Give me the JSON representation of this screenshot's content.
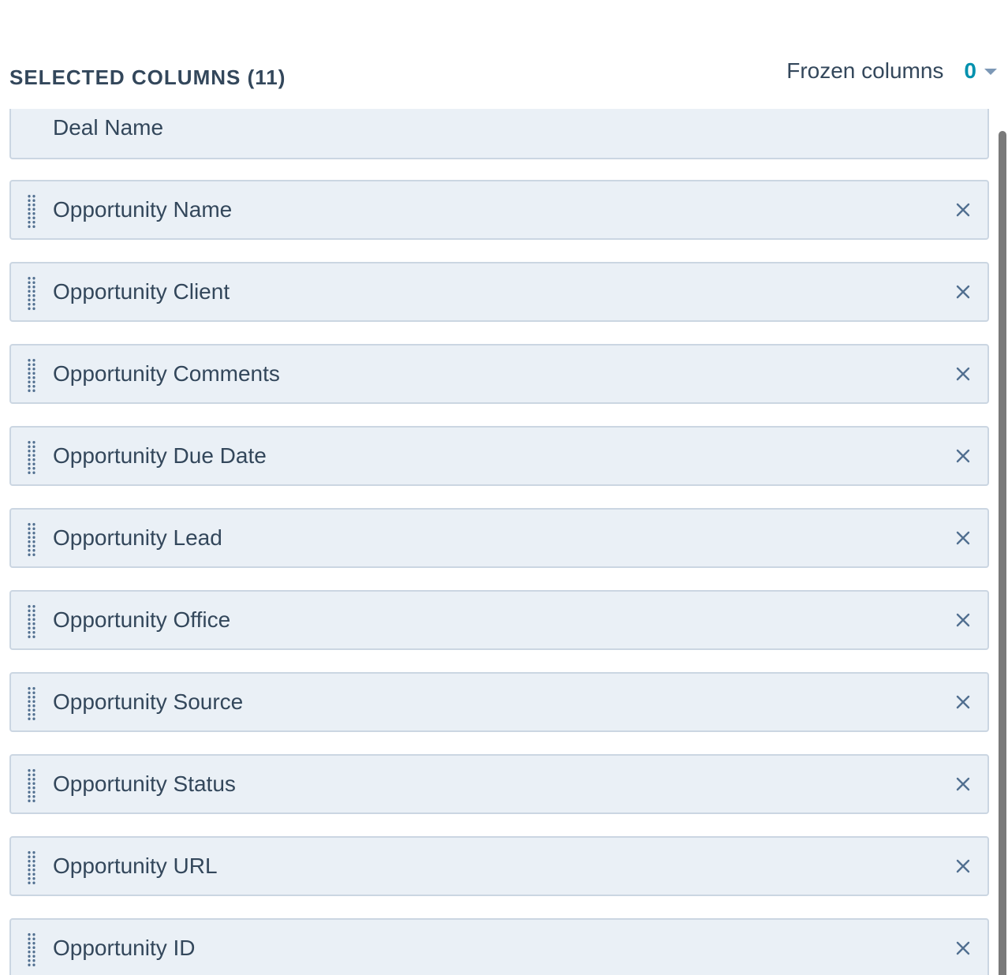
{
  "header": {
    "title": "SELECTED COLUMNS (11)",
    "frozen_label": "Frozen columns",
    "frozen_value": "0"
  },
  "columns": [
    {
      "label": "Deal Name",
      "removable": false
    },
    {
      "label": "Opportunity Name",
      "removable": true
    },
    {
      "label": "Opportunity Client",
      "removable": true
    },
    {
      "label": "Opportunity Comments",
      "removable": true
    },
    {
      "label": "Opportunity Due Date",
      "removable": true
    },
    {
      "label": "Opportunity Lead",
      "removable": true
    },
    {
      "label": "Opportunity Office",
      "removable": true
    },
    {
      "label": "Opportunity Source",
      "removable": true
    },
    {
      "label": "Opportunity Status",
      "removable": true
    },
    {
      "label": "Opportunity URL",
      "removable": true
    },
    {
      "label": "Opportunity ID",
      "removable": true
    }
  ],
  "colors": {
    "accent": "#0091ae",
    "item_bg": "#eaf0f6",
    "item_border": "#cbd6e2",
    "text": "#33475b",
    "icon": "#516f90"
  },
  "icons": {
    "drag": "drag-handle-icon",
    "remove": "close-icon",
    "dropdown": "chevron-down-icon"
  }
}
